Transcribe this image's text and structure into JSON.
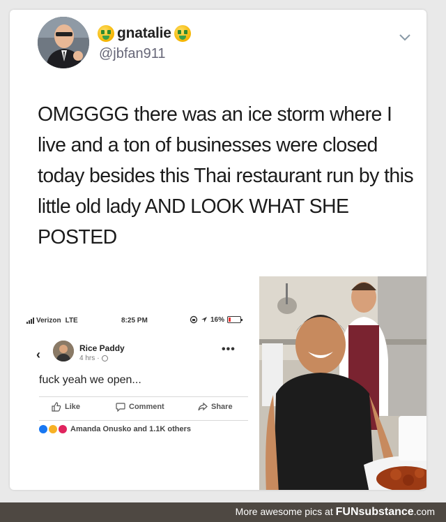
{
  "tweet": {
    "display_name": "gnatalie",
    "handle": "@jbfan911",
    "emoji": "money-mouth-face-icon",
    "text": "OMGGGG there was an ice storm where I live and a ton of businesses were closed today besides this Thai restaurant run by this little old lady AND LOOK WHAT SHE POSTED"
  },
  "facebook_post": {
    "status_bar": {
      "carrier": "Verizon",
      "network": "LTE",
      "time": "8:25 PM",
      "battery": "16%"
    },
    "page_name": "Rice Paddy",
    "time_ago": "4 hrs",
    "more": "•••",
    "text": "fuck yeah we open...",
    "actions": {
      "like": "Like",
      "comment": "Comment",
      "share": "Share"
    },
    "reactions_text": "Amanda Onusko and 1.1K others",
    "reaction_icons": [
      "like-icon",
      "haha-icon",
      "love-icon"
    ]
  },
  "photo": {
    "subject": "photo"
  },
  "footer": {
    "text": "More awesome pics at",
    "brand_prefix": "FUN",
    "brand_suffix": "substance",
    "brand_tld": ".com"
  },
  "colors": {
    "footer_bg": "#4e4842",
    "handle": "#667788",
    "fb_like": "#1877f2",
    "fb_love": "#e0245e",
    "fb_haha": "#f7b125"
  }
}
